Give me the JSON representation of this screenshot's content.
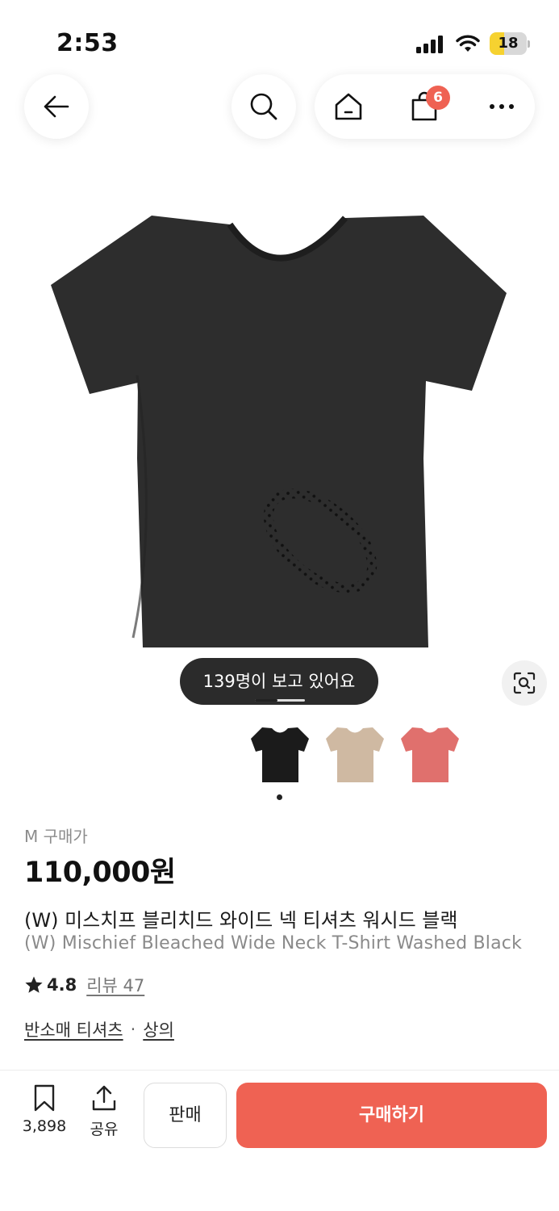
{
  "status_bar": {
    "time": "2:53",
    "battery": "18"
  },
  "nav": {
    "back_icon": "arrow-left-icon",
    "search_icon": "search-icon",
    "home_icon": "home-icon",
    "cart_icon": "shopping-bag-icon",
    "cart_badge": "6",
    "more_icon": "more-horizontal-icon"
  },
  "product_image": {
    "viewers": "139명이 보고 있어요",
    "lens_icon": "image-search-icon"
  },
  "variants": [
    {
      "color": "#1b1b1b",
      "selected": true
    },
    {
      "color": "#cfb9a2",
      "selected": false
    },
    {
      "color": "#e0706d",
      "selected": false
    }
  ],
  "product": {
    "size_label": "M 구매가",
    "price": "110,000원",
    "name_ko": "(W) 미스치프 블리치드 와이드 넥 티셔츠 워시드 블랙",
    "name_en": "(W) Mischief Bleached Wide Neck T-Shirt Washed Black",
    "rating": "4.8",
    "review_label": "리뷰 47",
    "categories": [
      "반소매 티셔츠",
      "상의"
    ],
    "category_separator": "·"
  },
  "bottom_bar": {
    "bookmark_count": "3,898",
    "share_label": "공유",
    "sell_label": "판매",
    "buy_label": "구매하기"
  },
  "colors": {
    "accent": "#ef6253",
    "text": "#222222",
    "muted": "#8a8a8a"
  }
}
